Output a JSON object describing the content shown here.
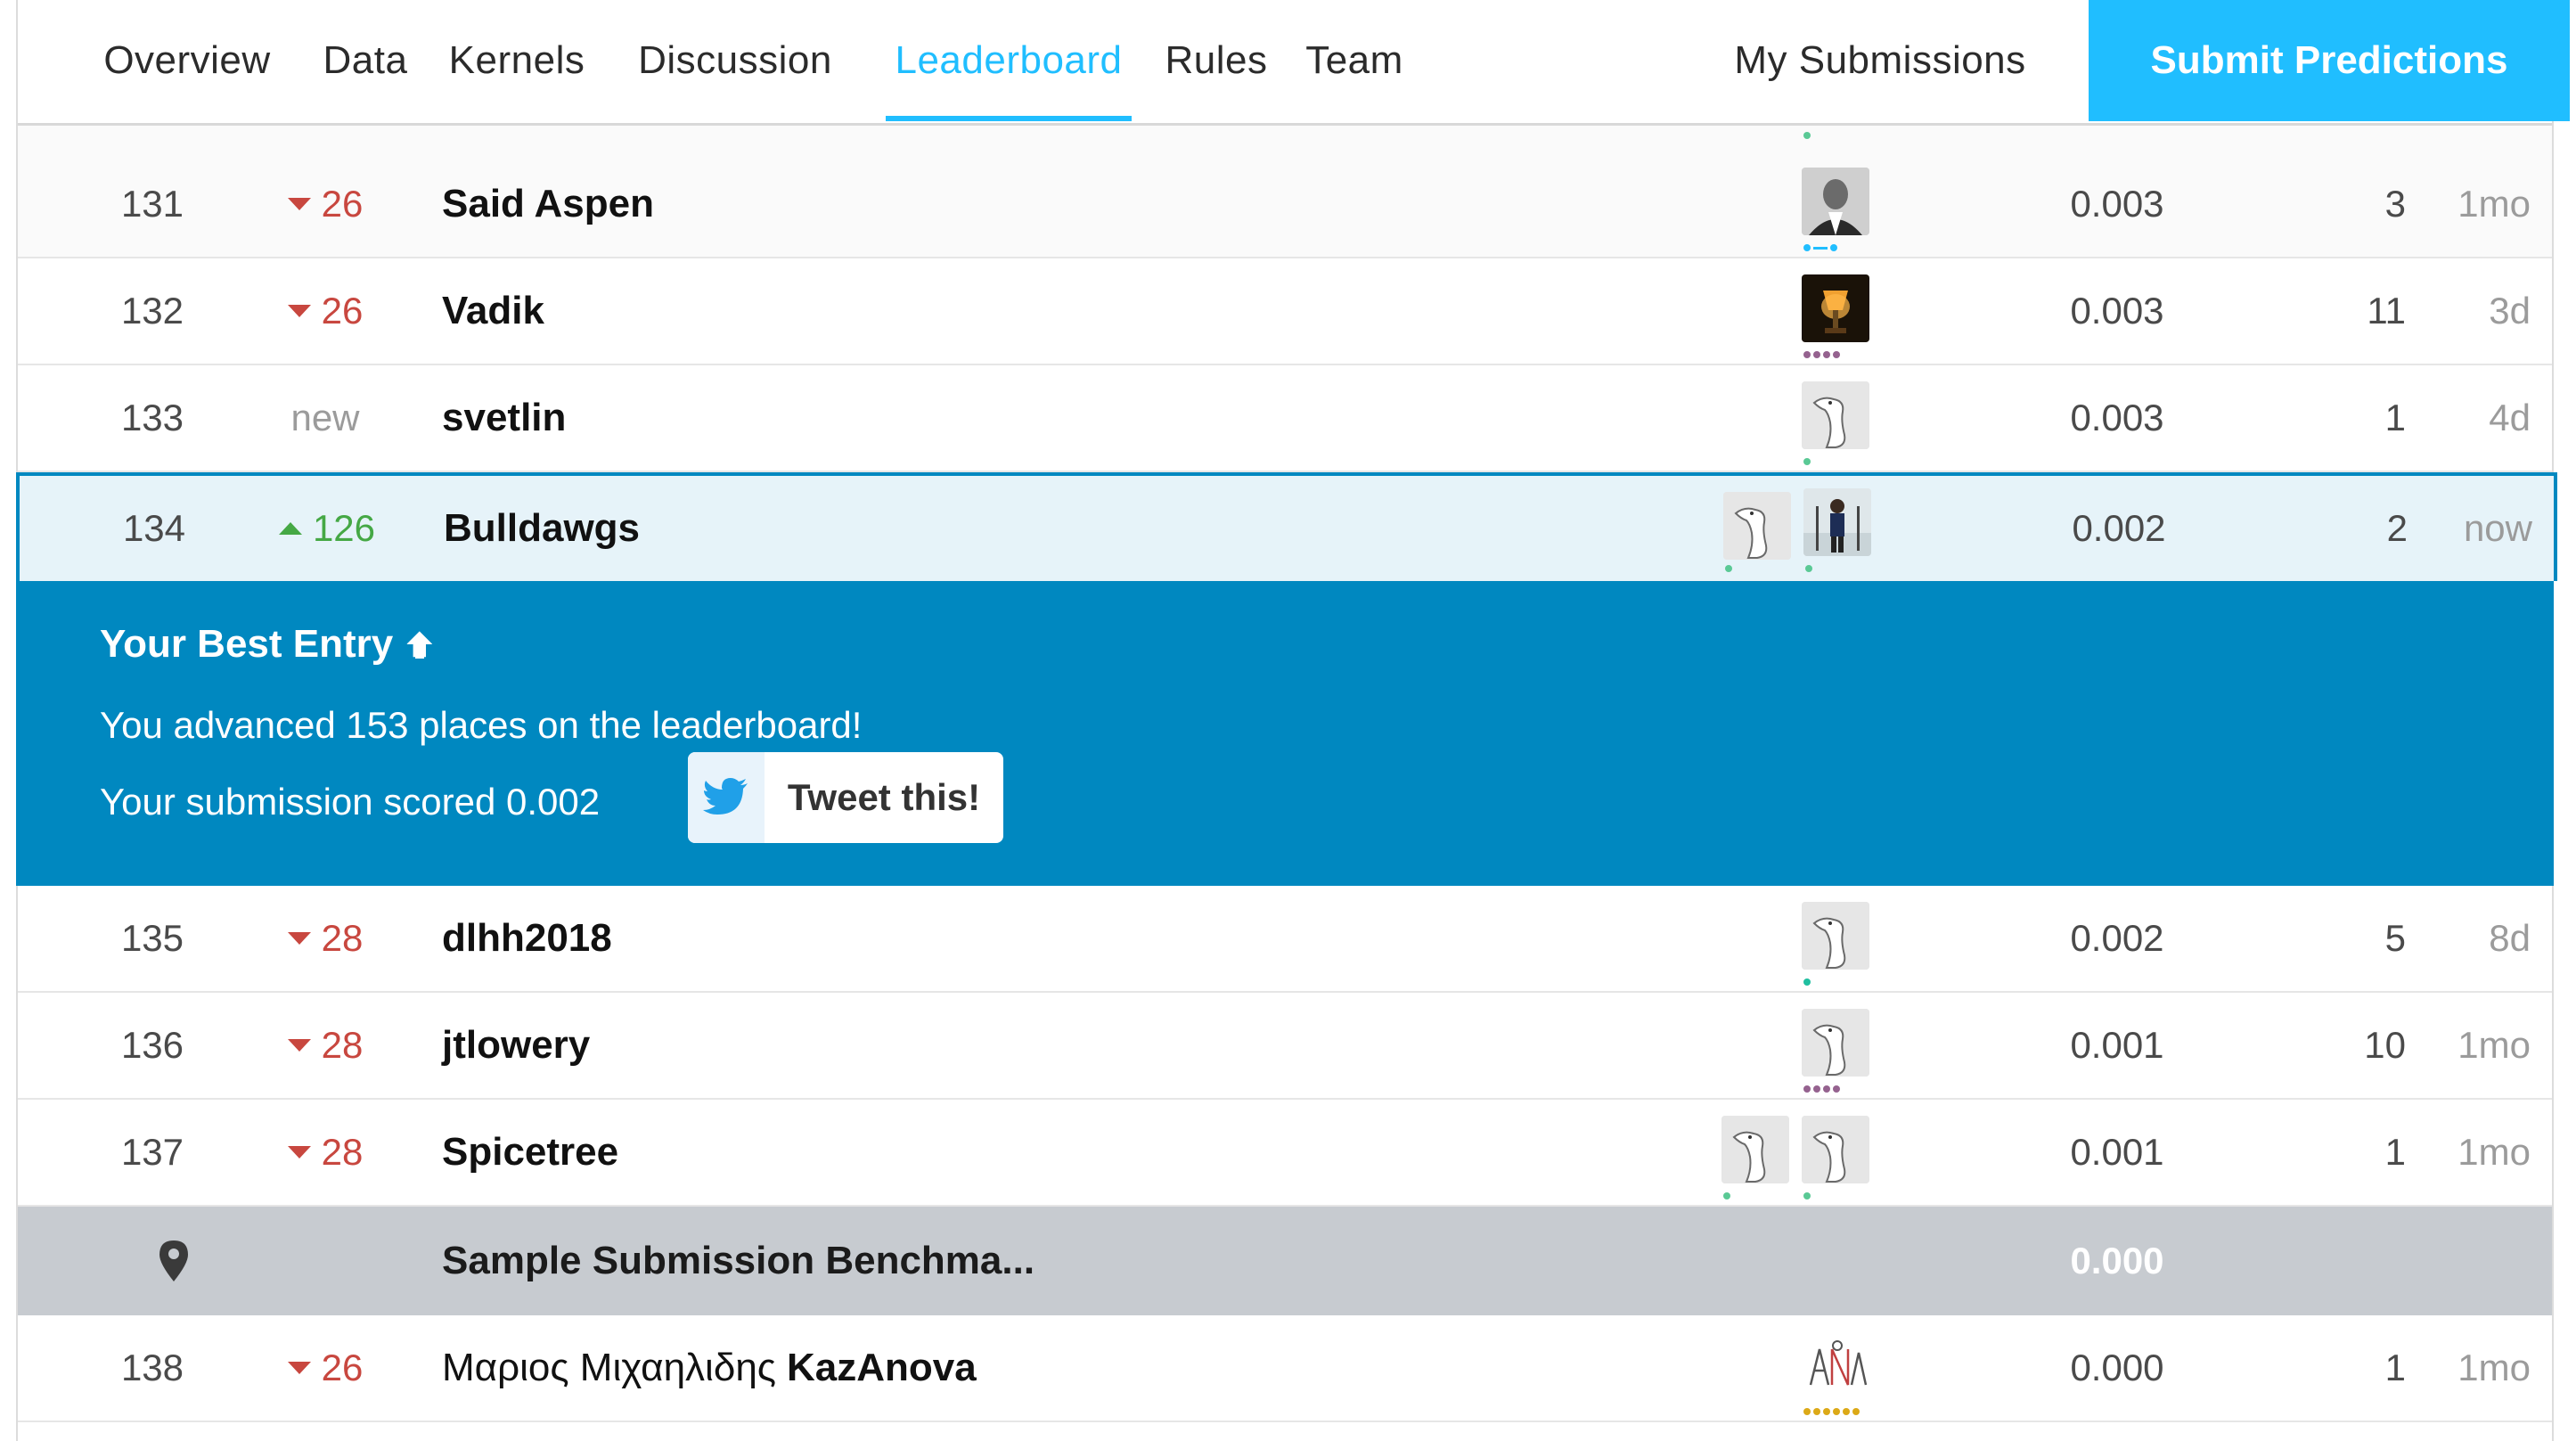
{
  "nav": {
    "tabs": [
      {
        "label": "Overview"
      },
      {
        "label": "Data"
      },
      {
        "label": "Kernels"
      },
      {
        "label": "Discussion"
      },
      {
        "label": "Leaderboard",
        "active": true
      },
      {
        "label": "Rules"
      },
      {
        "label": "Team"
      }
    ],
    "my_submissions": "My Submissions",
    "submit_predictions": "Submit Predictions"
  },
  "colors": {
    "accent": "#20beff",
    "banner": "#0088c0",
    "rank_down": "#c8473f",
    "rank_up": "#45a845",
    "benchmark_row": "#c7cbd0"
  },
  "rows_top": [
    {
      "rank": "131",
      "delta": "26",
      "delta_dir": "down",
      "team": "Said Aspen",
      "score": "0.003",
      "entries": "3",
      "last": "1mo"
    },
    {
      "rank": "132",
      "delta": "26",
      "delta_dir": "down",
      "team": "Vadik",
      "score": "0.003",
      "entries": "11",
      "last": "3d"
    },
    {
      "rank": "133",
      "delta": "new",
      "delta_dir": "new",
      "team": "svetlin",
      "score": "0.003",
      "entries": "1",
      "last": "4d"
    }
  ],
  "current_row": {
    "rank": "134",
    "delta": "126",
    "delta_dir": "up",
    "team": "Bulldawgs",
    "score": "0.002",
    "entries": "2",
    "last": "now"
  },
  "best_entry": {
    "title": "Your Best Entry",
    "advanced": "You advanced 153 places on the leaderboard!",
    "scored": "Your submission scored 0.002",
    "tweet": "Tweet this!"
  },
  "rows_bottom": [
    {
      "rank": "135",
      "delta": "28",
      "delta_dir": "down",
      "team": "dlhh2018",
      "score": "0.002",
      "entries": "5",
      "last": "8d"
    },
    {
      "rank": "136",
      "delta": "28",
      "delta_dir": "down",
      "team": "jtlowery",
      "score": "0.001",
      "entries": "10",
      "last": "1mo"
    },
    {
      "rank": "137",
      "delta": "28",
      "delta_dir": "down",
      "team": "Spicetree",
      "score": "0.001",
      "entries": "1",
      "last": "1mo"
    }
  ],
  "benchmark": {
    "team": "Sample Submission Benchma...",
    "score": "0.000"
  },
  "last_row": {
    "rank": "138",
    "delta": "26",
    "delta_dir": "down",
    "team_prefix": "Μαριος Μιχαηλιδης",
    "team": "KazAnova",
    "score": "0.000",
    "entries": "1",
    "last": "1mo"
  }
}
